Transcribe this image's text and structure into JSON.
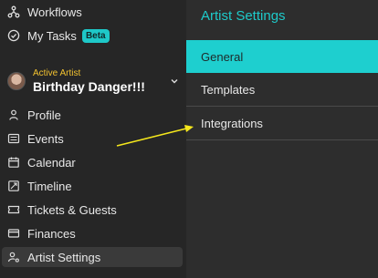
{
  "sidebar": {
    "top_items": [
      {
        "label": "Workflows"
      },
      {
        "label": "My Tasks",
        "badge": "Beta"
      }
    ],
    "artist": {
      "kicker": "Active Artist",
      "name": "Birthday Danger!!!"
    },
    "items": [
      {
        "label": "Profile"
      },
      {
        "label": "Events"
      },
      {
        "label": "Calendar"
      },
      {
        "label": "Timeline"
      },
      {
        "label": "Tickets & Guests"
      },
      {
        "label": "Finances"
      },
      {
        "label": "Artist Settings",
        "active": true
      }
    ]
  },
  "panel": {
    "title": "Artist Settings",
    "tabs": [
      {
        "label": "General",
        "active": true
      },
      {
        "label": "Templates"
      },
      {
        "label": "Integrations"
      }
    ]
  },
  "colors": {
    "accent": "#1ecfcf",
    "kicker": "#f2c230",
    "arrow": "#f5e71c"
  }
}
